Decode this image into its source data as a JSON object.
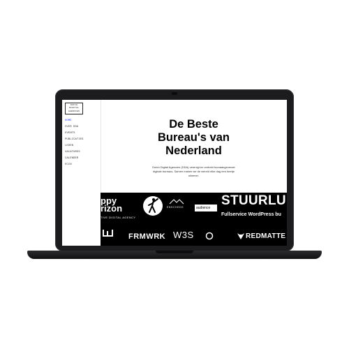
{
  "sidebar": {
    "logo_lines": [
      "DUTCH",
      "DIGITAL",
      "AGENCIES"
    ],
    "nav": [
      "HOME",
      "OVER DDA",
      "EVENTS",
      "PUBLICATIES",
      "LEDEN",
      "VACATURES",
      "CALENDER",
      "ECCN"
    ]
  },
  "hero": {
    "title_lines": [
      "De Beste",
      "Bureau's van",
      "Nederland"
    ],
    "subtitle_lines": [
      "Dutch Digital Agencies (DDA) verenigt en vertrekt toonaangevende",
      "digitale bureaus. Samen maken we de wereld elke dag een beetje",
      "slimmer."
    ]
  },
  "logos": {
    "happy_horizon": {
      "line1": "ppy",
      "line2": "rizon",
      "tagline": "TIVE DIGITAL AGENCY"
    },
    "enschede": "ENSCHEDE",
    "audience": "audience",
    "stuurlui": {
      "name": "STUURLU",
      "tagline": "Fullservice WordPress bu"
    },
    "framework": "FRMWRK",
    "w3s": "W3S",
    "redmatter": "REDMATTE"
  }
}
